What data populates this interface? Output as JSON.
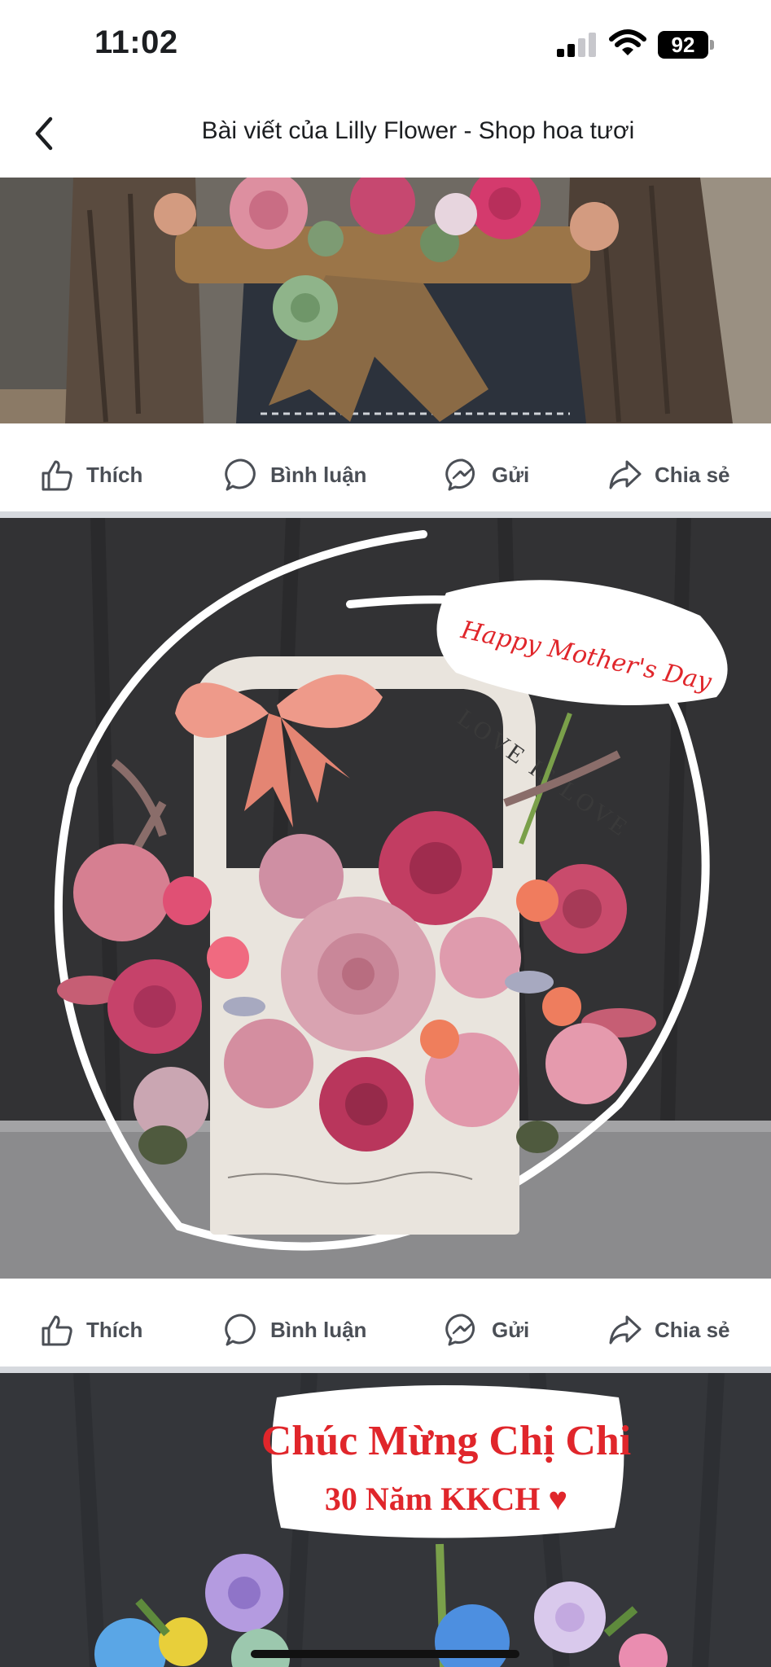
{
  "status_bar": {
    "time": "11:02",
    "battery": "92"
  },
  "header": {
    "title": "Bài viết của Lilly Flower - Shop hoa tươi"
  },
  "actions": {
    "like": "Thích",
    "comment": "Bình luận",
    "send": "Gửi",
    "share": "Chia sẻ"
  },
  "photos": {
    "photo2": {
      "sign_text": "Happy Mother's Day",
      "handle_text": "LOVE IS LOVE"
    },
    "photo3": {
      "sign_line1": "Chúc Mừng Chị Chi",
      "sign_line2": "30 Năm KKCH ♥"
    }
  },
  "colors": {
    "accent_red": "#e0262b",
    "action_text": "#4b4f56",
    "separator": "#d6d9de"
  },
  "icons": [
    "back-chevron-icon",
    "signal-icon",
    "wifi-icon",
    "battery-icon",
    "like-icon",
    "comment-icon",
    "messenger-icon",
    "share-icon"
  ]
}
